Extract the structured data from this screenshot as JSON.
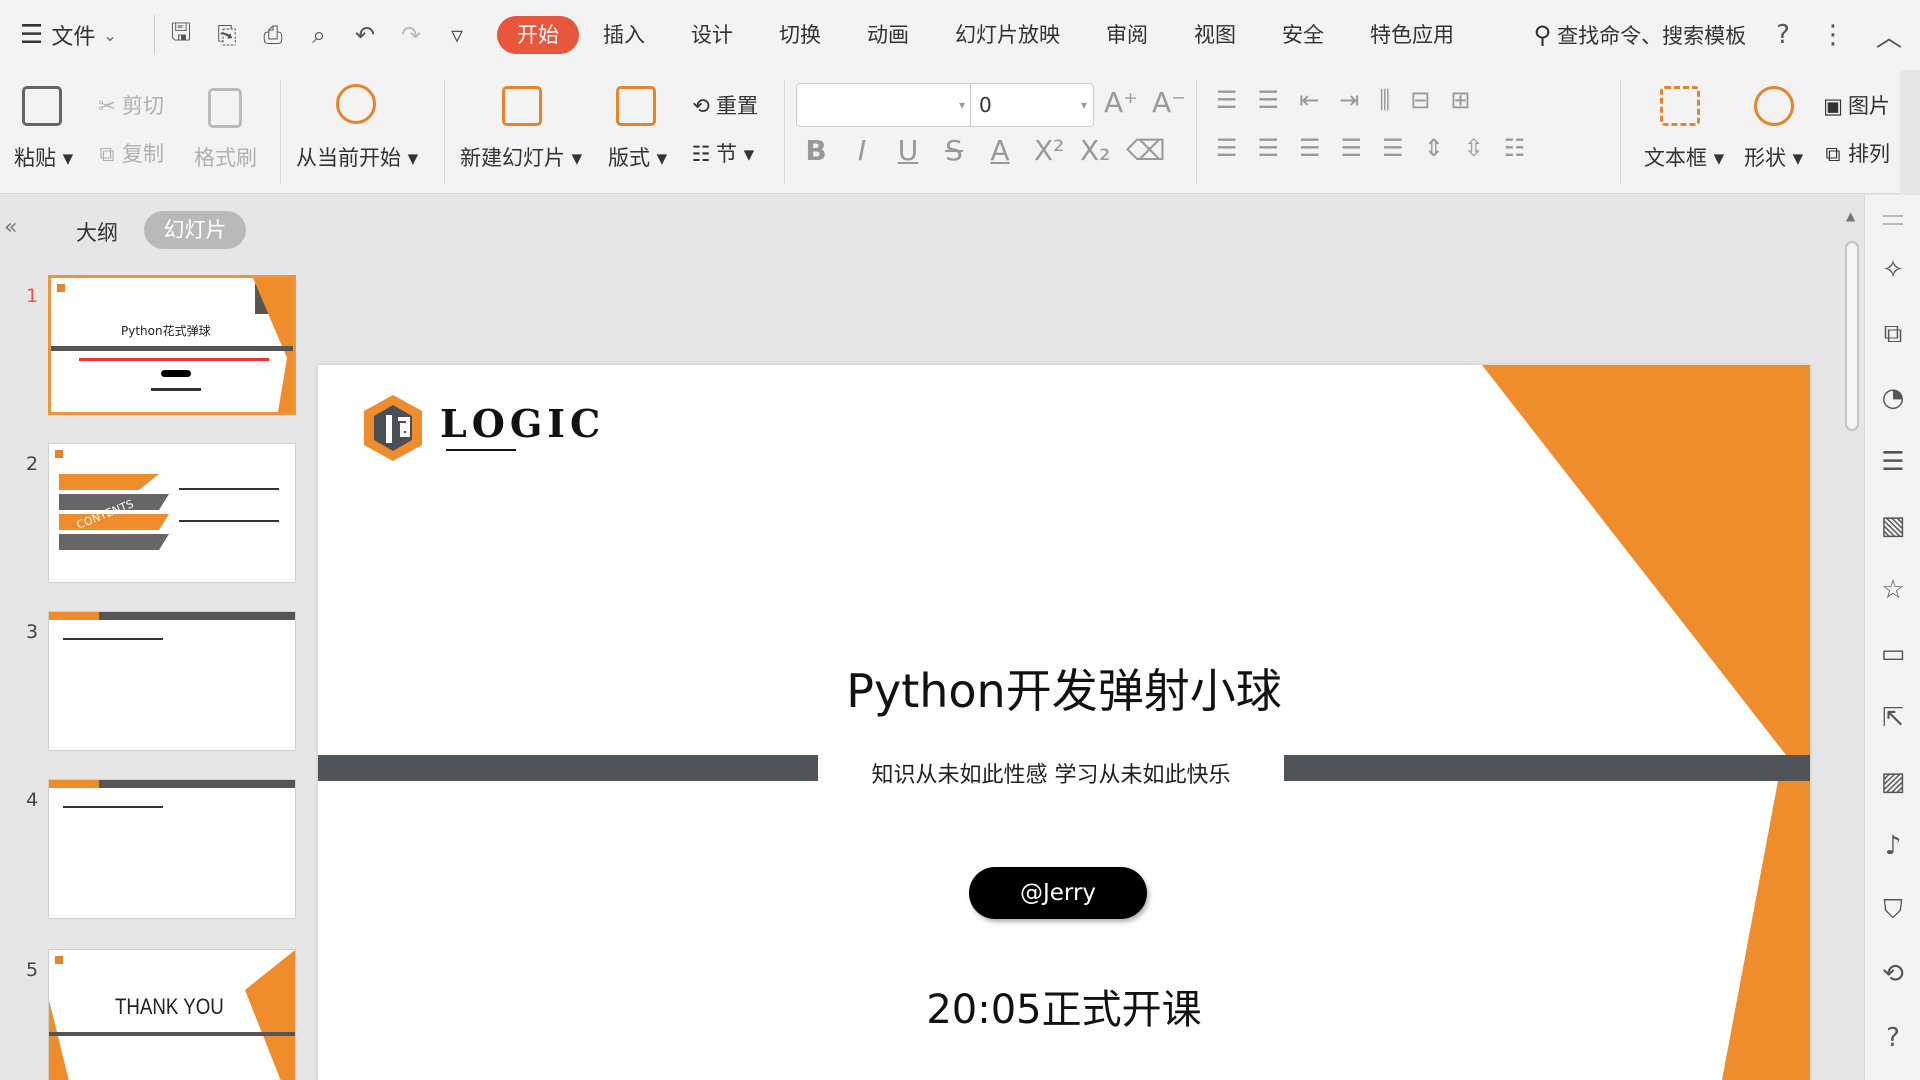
{
  "menubar": {
    "file_label": "文件",
    "tabs": [
      {
        "label": "开始",
        "active": true
      },
      {
        "label": "插入",
        "active": false
      },
      {
        "label": "设计",
        "active": false
      },
      {
        "label": "切换",
        "active": false
      },
      {
        "label": "动画",
        "active": false
      },
      {
        "label": "幻灯片放映",
        "active": false
      },
      {
        "label": "审阅",
        "active": false
      },
      {
        "label": "视图",
        "active": false
      },
      {
        "label": "安全",
        "active": false
      },
      {
        "label": "特色应用",
        "active": false
      }
    ],
    "search_label": "查找命令、搜索模板",
    "help_icon": "?",
    "accent_color": "#e8563b"
  },
  "ribbon": {
    "paste": "粘贴",
    "cut": "剪切",
    "copy": "复制",
    "format_painter": "格式刷",
    "from_current": "从当前开始",
    "new_slide": "新建幻灯片",
    "layout": "版式",
    "reset": "重置",
    "section": "节",
    "font_size": "0",
    "textbox": "文本框",
    "shape": "形状",
    "picture": "图片",
    "arrange": "排列"
  },
  "leftpanel": {
    "outline_tab": "大纲",
    "slides_tab": "幻灯片",
    "thumbnails": [
      {
        "num": "1",
        "title": "Python花式弹球",
        "active": true
      },
      {
        "num": "2",
        "title": "CONTENTS",
        "active": false
      },
      {
        "num": "3",
        "title": "",
        "active": false
      },
      {
        "num": "4",
        "title": "",
        "active": false
      },
      {
        "num": "5",
        "title": "THANK YOU",
        "active": false
      }
    ]
  },
  "slide": {
    "logo_text": "LOGIC",
    "title": "Python开发弹射小球",
    "subtitle": "知识从未如此性感  学习从未如此快乐",
    "presenter": "@Jerry",
    "start_time": "20:05正式开课",
    "orange": "#ef8c2b",
    "band_color": "#505459"
  }
}
